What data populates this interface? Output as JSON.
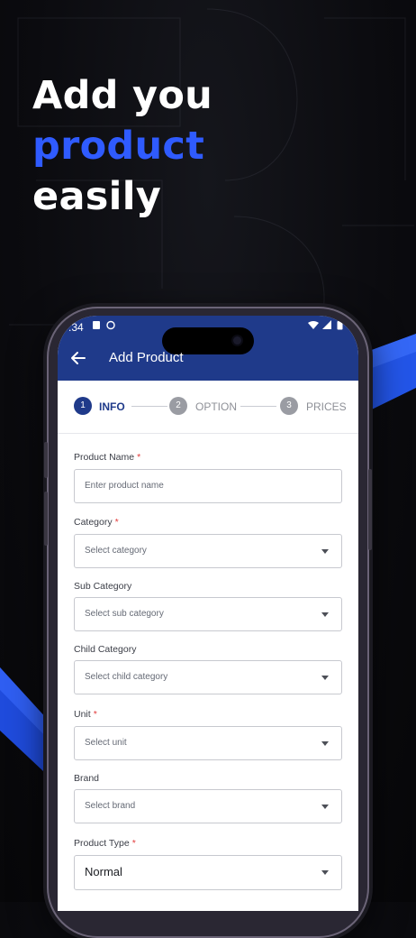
{
  "headline": {
    "line1": "Add you",
    "accent": "product",
    "line2": "easily"
  },
  "status_bar": {
    "time": ":34"
  },
  "app_bar": {
    "title": "Add Product"
  },
  "steps": [
    {
      "number": "1",
      "label": "INFO",
      "active": true
    },
    {
      "number": "2",
      "label": "OPTION",
      "active": false
    },
    {
      "number": "3",
      "label": "PRICES",
      "active": false
    }
  ],
  "form": {
    "product_name": {
      "label": "Product Name",
      "required": "*",
      "placeholder": "Enter product name"
    },
    "category": {
      "label": "Category",
      "required": "*",
      "placeholder": "Select category"
    },
    "sub_category": {
      "label": "Sub Category",
      "placeholder": "Select sub category"
    },
    "child_category": {
      "label": "Child Category",
      "placeholder": "Select child category"
    },
    "unit": {
      "label": "Unit",
      "required": "*",
      "placeholder": "Select unit"
    },
    "brand": {
      "label": "Brand",
      "placeholder": "Select brand"
    },
    "product_type": {
      "label": "Product Type",
      "required": "*",
      "value": "Normal"
    }
  },
  "colors": {
    "accent": "#2f5bff",
    "app_bar": "#1f3a8a",
    "active_step": "#1f3a8a",
    "inactive_step": "#9a9ca3"
  }
}
